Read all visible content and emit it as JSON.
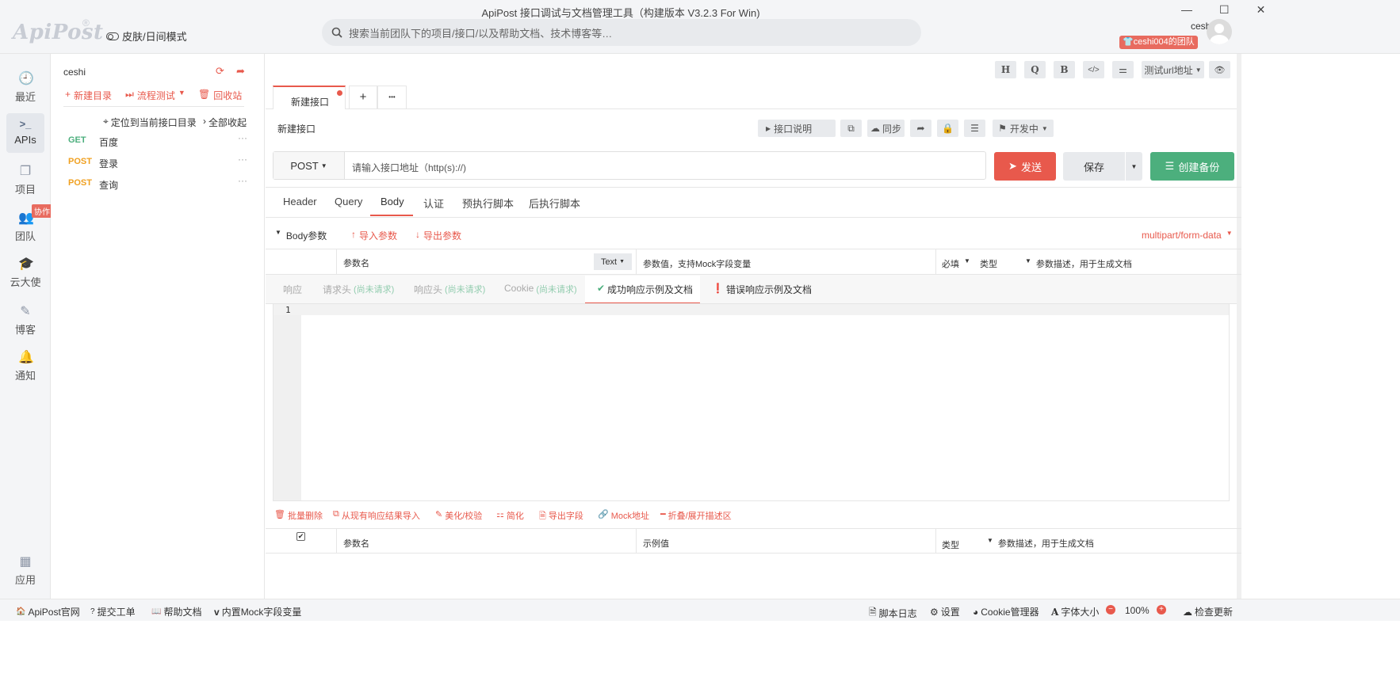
{
  "window": {
    "title": "ApiPost 接口调试与文档管理工具（构建版本 V3.2.3 For Win)",
    "controls": [
      "—",
      "☐",
      "✕"
    ]
  },
  "brand": {
    "logo": "ApiPost",
    "reg": "®"
  },
  "header": {
    "skin_label": "皮肤/日间模式",
    "search_placeholder": "搜索当前团队下的项目/接口/以及帮助文档、技术博客等…",
    "user": "ceshi004",
    "team": "ceshi004的团队"
  },
  "nav": [
    {
      "label": "最近",
      "icon": "clock-icon"
    },
    {
      "label": "APIs",
      "icon": "terminal-icon"
    },
    {
      "label": "项目",
      "icon": "project-icon"
    },
    {
      "label": "团队",
      "icon": "team-icon",
      "badge": "协作"
    },
    {
      "label": "云大使",
      "icon": "graduation-icon"
    },
    {
      "label": "博客",
      "icon": "edit-icon"
    },
    {
      "label": "通知",
      "icon": "bell-icon"
    },
    {
      "label": "应用",
      "icon": "apps-icon"
    }
  ],
  "tree": {
    "project": "ceshi",
    "actions": {
      "new_dir": "新建目录",
      "flow_test": "流程测试",
      "recycle": "回收站"
    },
    "locate": "定位到当前接口目录",
    "collapse": "全部收起",
    "items": [
      {
        "method": "GET",
        "name": "百度"
      },
      {
        "method": "POST",
        "name": "登录"
      },
      {
        "method": "POST",
        "name": "查询"
      }
    ]
  },
  "toolbar_top": {
    "h": "H",
    "q": "Q",
    "b": "B",
    "code": "</>",
    "settings": "⚌",
    "env": "测试url地址",
    "eye": "👁"
  },
  "tabs": {
    "active": "新建接口",
    "add": "+",
    "more": "•••"
  },
  "api": {
    "name": "新建接口",
    "doc_btn": "接口说明",
    "sync_btn": "同步",
    "status": "开发中",
    "method": "POST",
    "url_placeholder": "请输入接口地址（http(s)://)",
    "send": "发送",
    "save": "保存",
    "backup": "创建备份"
  },
  "req_tabs": [
    "Header",
    "Query",
    "Body",
    "认证",
    "预执行脚本",
    "后执行脚本"
  ],
  "body": {
    "title": "Body参数",
    "import": "导入参数",
    "export": "导出参数",
    "content_type": "multipart/form-data",
    "col_name": "参数名",
    "type_sel": "Text",
    "col_value": "参数值，支持Mock字段变量",
    "col_required": "必填",
    "col_type": "类型",
    "col_desc": "参数描述，用于生成文档"
  },
  "resp_tabs": {
    "resp": "响应",
    "req_header": "请求头",
    "resp_header": "响应头",
    "cookie": "Cookie",
    "not_requested": "(尚未请求)",
    "success": "成功响应示例及文档",
    "error": "错误响应示例及文档"
  },
  "editor": {
    "line": "1"
  },
  "resp_tools": [
    "批量删除",
    "从现有响应结果导入",
    "美化/校验",
    "简化",
    "导出字段",
    "Mock地址",
    "折叠/展开描述区"
  ],
  "resp_table": {
    "col_name": "参数名",
    "col_example": "示例值",
    "col_type": "类型",
    "col_desc": "参数描述，用于生成文档"
  },
  "statusbar": {
    "site": "ApiPost官网",
    "ticket": "提交工单",
    "help": "帮助文档",
    "mock": "内置Mock字段变量",
    "script_log": "脚本日志",
    "settings": "设置",
    "cookie_mgr": "Cookie管理器",
    "font_size": "字体大小",
    "zoom": "100%",
    "update": "检查更新"
  },
  "colors": {
    "accent": "#e8594c",
    "green": "#4caf7d",
    "orange": "#f0a020",
    "sidebar": "#f4f5f7"
  }
}
